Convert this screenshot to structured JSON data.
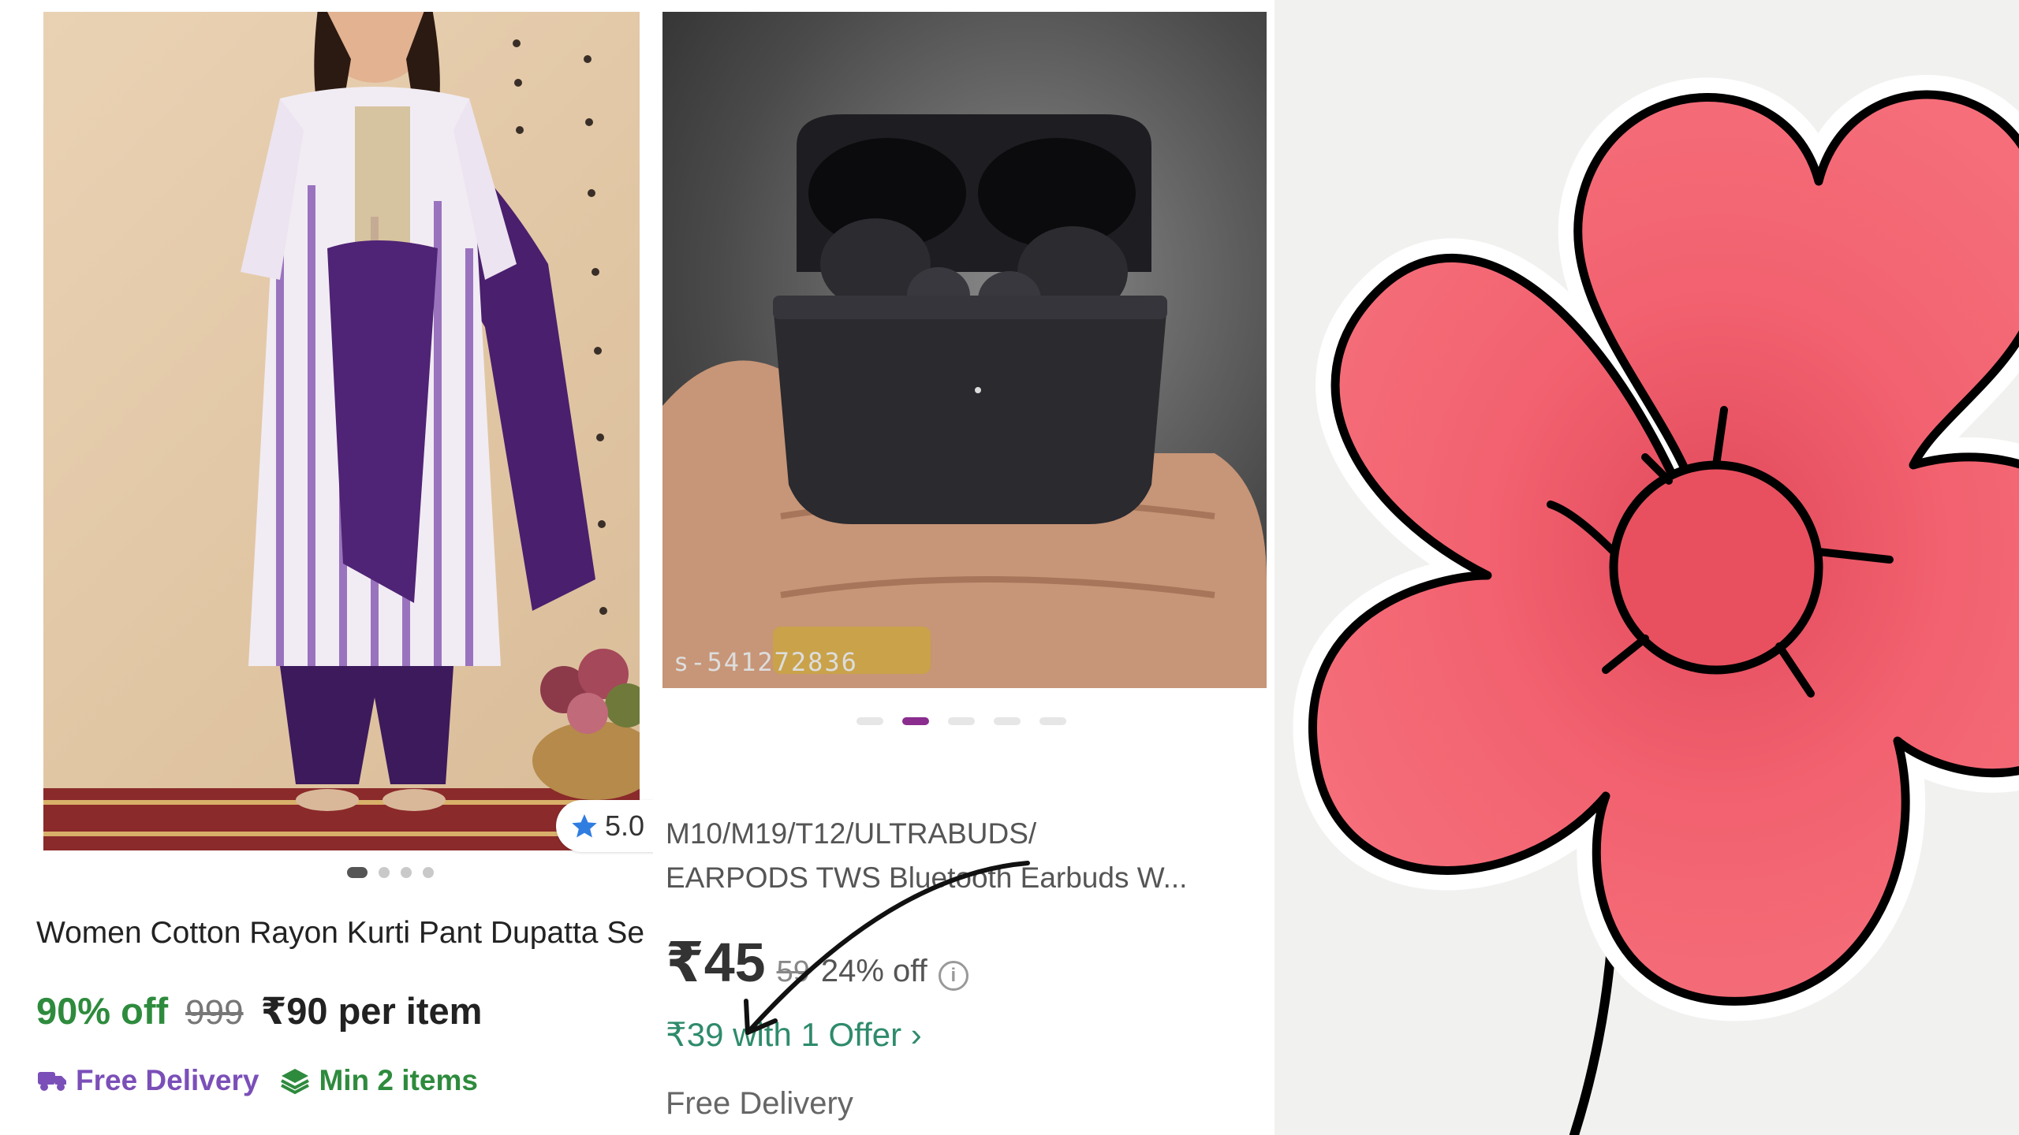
{
  "kurti_card": {
    "rating": "5.0",
    "title": "Women Cotton Rayon Kurti Pant Dupatta Set",
    "discount": "90% off",
    "mrp": "999",
    "price": "₹90 per item",
    "free_delivery": "Free Delivery",
    "min_items": "Min 2 items",
    "carousel_dots": 4,
    "carousel_active": 0
  },
  "earbuds_card": {
    "watermark": "s-541272836",
    "title_line1": "M10/M19/T12/ULTRABUDS/",
    "title_line2": "EARPODS TWS Bluetooth Earbuds W...",
    "price": "₹45",
    "mrp": "59",
    "discount": "24% off",
    "offer": "₹39 with 1 Offer ›",
    "delivery": "Free Delivery",
    "carousel_dots": 5,
    "carousel_active": 1
  },
  "colors": {
    "green": "#2e8b3d",
    "purple": "#7b4fb8",
    "offer_green": "#2e8b6b",
    "dot_active": "#8a2d8f",
    "flower_pink": "#f2616f"
  },
  "icons": [
    "star-icon",
    "truck-icon",
    "layers-icon",
    "info-icon",
    "chevron-right-icon"
  ]
}
